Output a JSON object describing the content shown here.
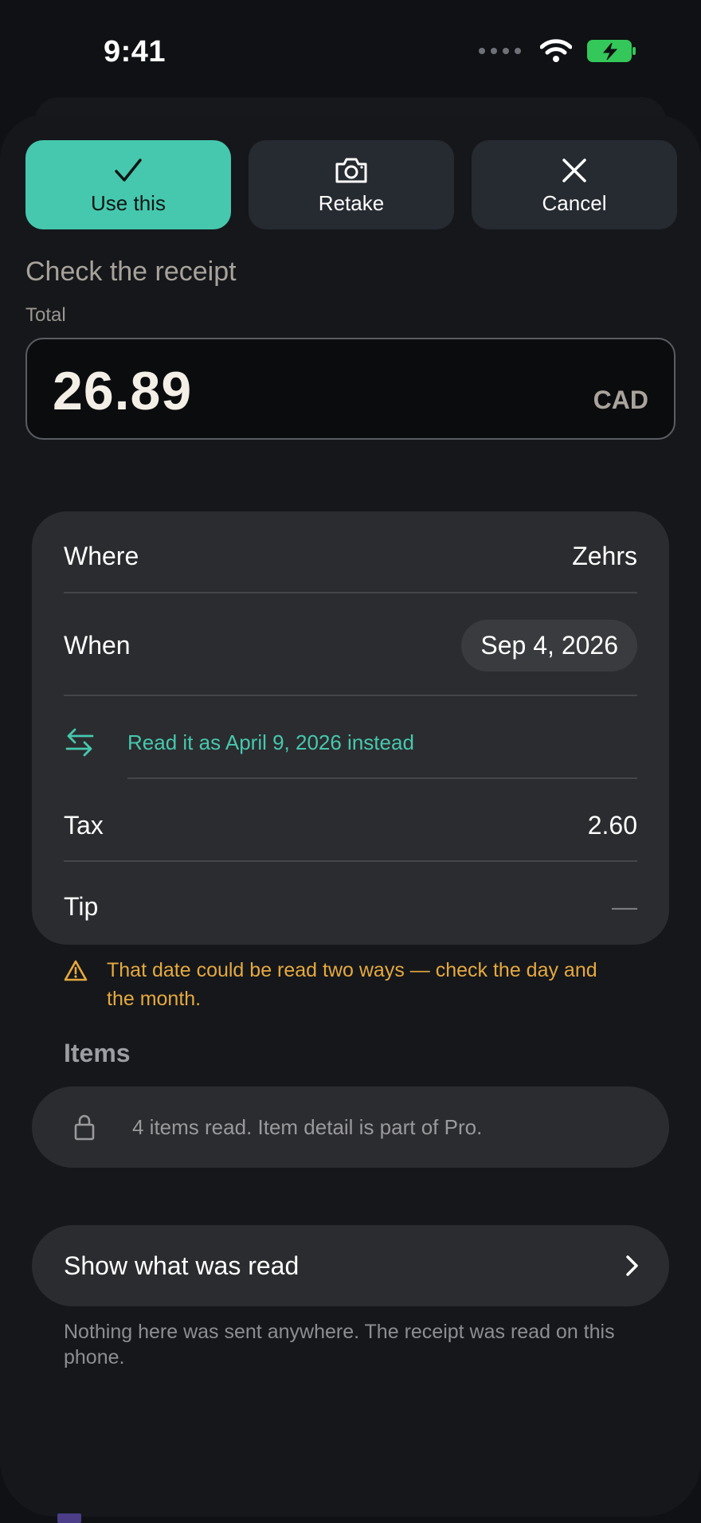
{
  "status": {
    "time": "9:41"
  },
  "actions": {
    "use_label": "Use this",
    "retake_label": "Retake",
    "cancel_label": "Cancel"
  },
  "receipt": {
    "title": "Check the receipt",
    "total_label": "Total",
    "total_value": "26.89",
    "currency": "CAD"
  },
  "details": {
    "where_label": "Where",
    "where_value": "Zehrs",
    "when_label": "When",
    "when_value": "Sep 4, 2026",
    "swap_text": "Read it as April 9, 2026 instead",
    "tax_label": "Tax",
    "tax_value": "2.60",
    "tip_label": "Tip",
    "tip_value": "—"
  },
  "warning": {
    "text": "That date could be read two ways — check the day and the month."
  },
  "items": {
    "title": "Items",
    "text": "4 items read. Item detail is part of Pro."
  },
  "show_read": {
    "label": "Show what was read"
  },
  "footnote": "Nothing here was sent anywhere. The receipt was read on this phone.",
  "colors": {
    "accent": "#46c8ae",
    "warning": "#e6a93e",
    "battery": "#34c759"
  },
  "icons": [
    "check-icon",
    "camera-icon",
    "close-icon",
    "swap-arrows-icon",
    "warning-icon",
    "lock-icon",
    "chevron-right-icon",
    "wifi-icon",
    "battery-icon"
  ]
}
